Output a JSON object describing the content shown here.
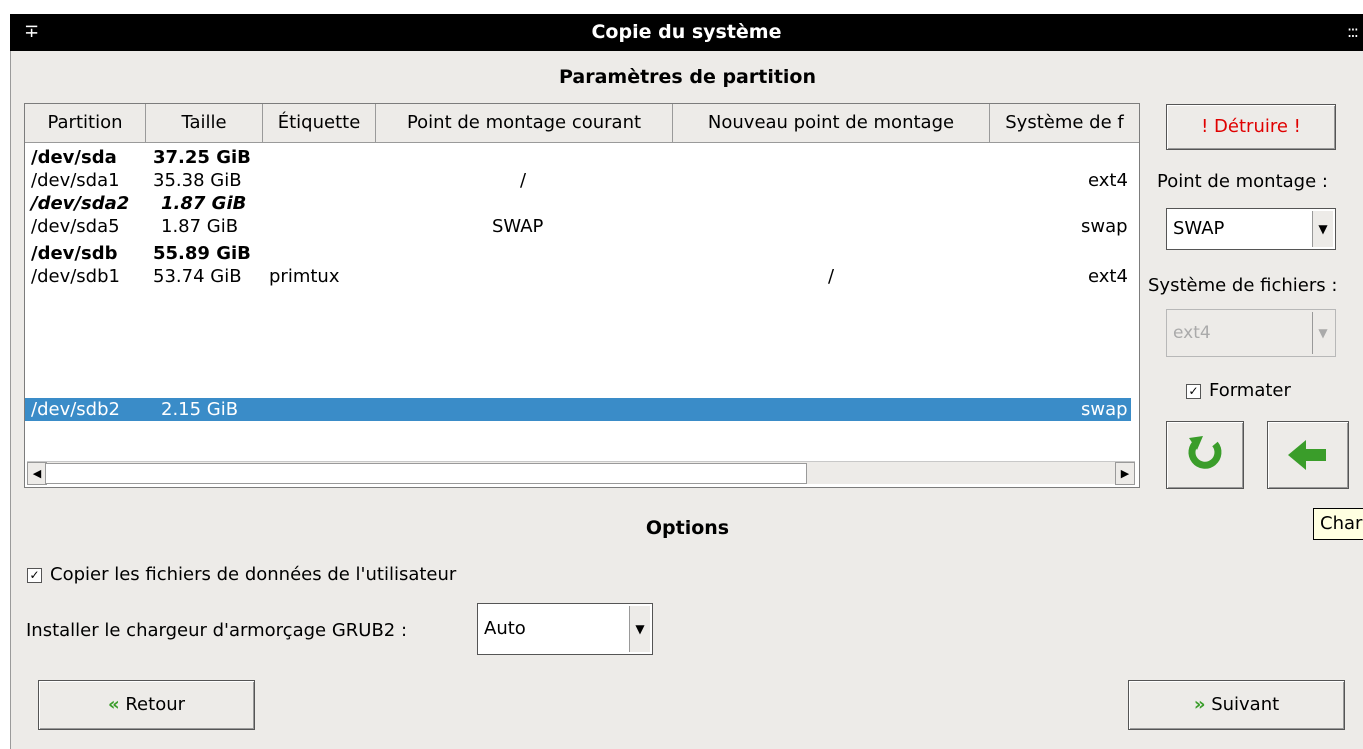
{
  "window": {
    "title": "Copie du système",
    "pin_glyph": "∓",
    "grip_glyph": ":::"
  },
  "partition": {
    "section_title": "Paramètres de partition",
    "columns": [
      "Partition",
      "Taille",
      "Étiquette",
      "Point de montage courant",
      "Nouveau point de montage",
      "Système de f"
    ],
    "rows": [
      {
        "partition": "/dev/sda",
        "size": "37.25 GiB",
        "label": "",
        "current_mount": "",
        "new_mount": "",
        "fs": "",
        "style": "bold"
      },
      {
        "partition": "/dev/sda1",
        "size": "35.38 GiB",
        "label": "",
        "current_mount": "/",
        "new_mount": "",
        "fs": "ext4",
        "style": "normal"
      },
      {
        "partition": "/dev/sda2",
        "size": "1.87 GiB",
        "label": "",
        "current_mount": "",
        "new_mount": "",
        "fs": "",
        "style": "italic"
      },
      {
        "partition": "/dev/sda5",
        "size": "1.87 GiB",
        "label": "",
        "current_mount": "SWAP",
        "new_mount": "",
        "fs": "swap",
        "style": "normal"
      },
      {
        "partition": "/dev/sdb",
        "size": "55.89 GiB",
        "label": "",
        "current_mount": "",
        "new_mount": "",
        "fs": "",
        "style": "bold"
      },
      {
        "partition": "/dev/sdb1",
        "size": "53.74 GiB",
        "label": "primtux",
        "current_mount": "",
        "new_mount": "/",
        "fs": "ext4",
        "style": "normal"
      },
      {
        "partition": "/dev/sdb2",
        "size": "2.15 GiB",
        "label": "",
        "current_mount": "",
        "new_mount": "",
        "fs": "swap",
        "style": "selected"
      }
    ]
  },
  "side_panel": {
    "destroy_label": "! Détruire !",
    "destroy_color": "#e00000",
    "mount_point_label": "Point de montage :",
    "mount_point_value": "SWAP",
    "fs_label": "Système de fichiers :",
    "fs_value": "ext4",
    "format_label": "Formater",
    "format_checked": true,
    "refresh_icon": "refresh-icon",
    "apply_icon": "left-arrow-icon"
  },
  "tooltip": {
    "text": "Char"
  },
  "options": {
    "section_title": "Options",
    "copy_user_data_label": "Copier les fichiers de données de l'utilisateur",
    "copy_user_data_checked": true,
    "grub_label": "Installer le chargeur d'armorçage GRUB2 :",
    "grub_value": "Auto"
  },
  "nav": {
    "back_label": "Retour",
    "back_icon": "«",
    "next_label": "Suivant",
    "next_icon": "»",
    "accent_color": "#3a9d2a"
  }
}
